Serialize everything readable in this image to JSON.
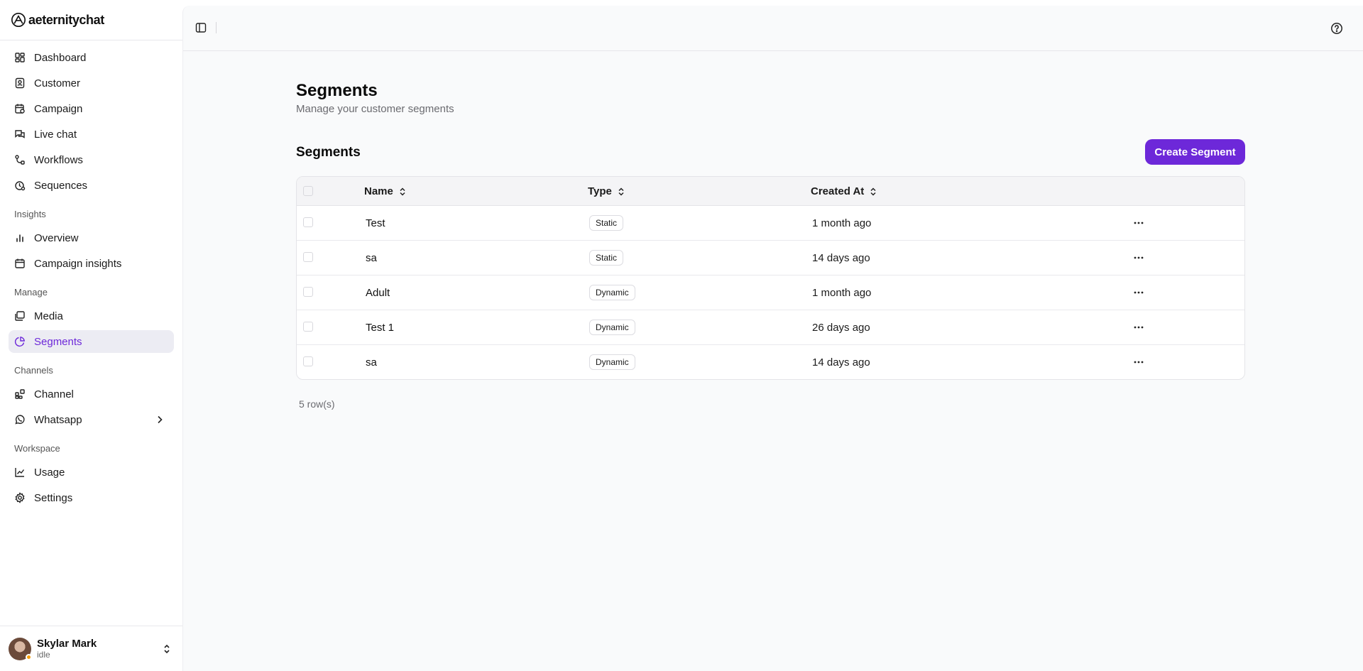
{
  "brand": {
    "name": "aeternitychat"
  },
  "sidebar": {
    "main_items": [
      {
        "label": "Dashboard",
        "icon": "dashboard-icon"
      },
      {
        "label": "Customer",
        "icon": "customer-icon"
      },
      {
        "label": "Campaign",
        "icon": "campaign-icon"
      },
      {
        "label": "Live chat",
        "icon": "chat-icon"
      },
      {
        "label": "Workflows",
        "icon": "workflow-icon"
      },
      {
        "label": "Sequences",
        "icon": "sequence-icon"
      }
    ],
    "insights": {
      "label": "Insights",
      "items": [
        {
          "label": "Overview",
          "icon": "bar-chart-icon"
        },
        {
          "label": "Campaign insights",
          "icon": "calendar-icon"
        }
      ]
    },
    "manage": {
      "label": "Manage",
      "items": [
        {
          "label": "Media",
          "icon": "media-icon"
        },
        {
          "label": "Segments",
          "icon": "pie-chart-icon",
          "active": true
        }
      ]
    },
    "channels": {
      "label": "Channels",
      "items": [
        {
          "label": "Channel",
          "icon": "channel-icon"
        },
        {
          "label": "Whatsapp",
          "icon": "whatsapp-icon"
        }
      ]
    },
    "workspace": {
      "label": "Workspace",
      "items": [
        {
          "label": "Usage",
          "icon": "line-chart-icon"
        },
        {
          "label": "Settings",
          "icon": "gear-icon"
        }
      ]
    },
    "user": {
      "name": "Skylar Mark",
      "status": "idle"
    }
  },
  "page": {
    "title": "Segments",
    "subtitle": "Manage your customer segments",
    "section_title": "Segments",
    "create_button": "Create Segment"
  },
  "table": {
    "columns": [
      "Name",
      "Type",
      "Created At"
    ],
    "rows": [
      {
        "name": "Test",
        "type": "Static",
        "created": "1 month ago"
      },
      {
        "name": "sa",
        "type": "Static",
        "created": "14 days ago"
      },
      {
        "name": "Adult",
        "type": "Dynamic",
        "created": "1 month ago"
      },
      {
        "name": "Test 1",
        "type": "Dynamic",
        "created": "26 days ago"
      },
      {
        "name": "sa",
        "type": "Dynamic",
        "created": "14 days ago"
      }
    ],
    "row_count": "5 row(s)"
  },
  "colors": {
    "accent": "#6d28d9",
    "active_bg": "#ececf3",
    "main_bg": "#f9fafb"
  }
}
